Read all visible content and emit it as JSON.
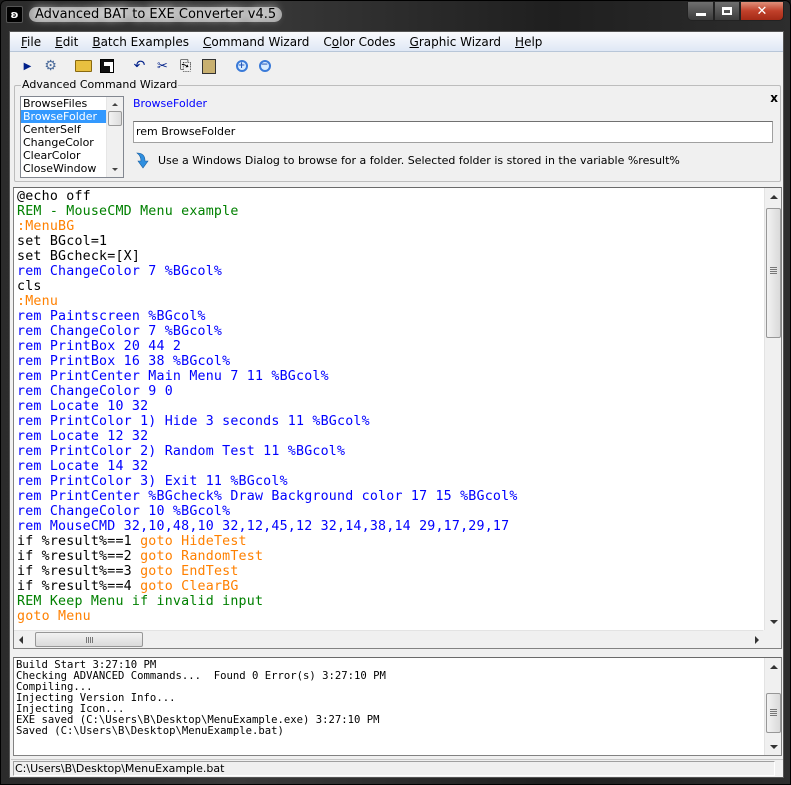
{
  "window": {
    "title": "Advanced BAT to EXE Converter v4.5",
    "app_icon": "bat-converter-logo-icon",
    "caption_buttons": {
      "minimize": "minimize-icon",
      "maximize": "maximize-icon",
      "close": "close-icon"
    }
  },
  "menubar": {
    "items": [
      {
        "label": "File",
        "accel": "F",
        "rest": "ile"
      },
      {
        "label": "Edit",
        "accel": "E",
        "rest": "dit"
      },
      {
        "label": "Batch Examples",
        "accel": "B",
        "rest": "atch Examples"
      },
      {
        "label": "Command Wizard",
        "accel": "C",
        "rest": "ommand Wizard"
      },
      {
        "label": "Color Codes",
        "pre": "C",
        "accel": "o",
        "rest": "lor Codes"
      },
      {
        "label": "Graphic Wizard",
        "accel": "G",
        "rest": "raphic Wizard"
      },
      {
        "label": "Help",
        "accel": "H",
        "rest": "elp"
      }
    ]
  },
  "toolbar": {
    "buttons": [
      {
        "name": "run",
        "icon": "play-icon",
        "glyph": "▶"
      },
      {
        "name": "build",
        "icon": "build-exe-icon",
        "glyph": "⚙"
      },
      {
        "name": "open",
        "icon": "open-folder-icon",
        "glyph": "📂"
      },
      {
        "name": "save",
        "icon": "save-disk-icon",
        "glyph": "💾"
      },
      {
        "name": "undo",
        "icon": "undo-icon",
        "glyph": "↶"
      },
      {
        "name": "cut",
        "icon": "scissors-icon",
        "glyph": "✂"
      },
      {
        "name": "copy",
        "icon": "copy-icon",
        "glyph": "⎘"
      },
      {
        "name": "paste",
        "icon": "paste-icon",
        "glyph": "📋"
      },
      {
        "name": "zoom-in",
        "icon": "zoom-in-icon",
        "glyph": "⊕"
      },
      {
        "name": "zoom-out",
        "icon": "zoom-out-icon",
        "glyph": "⊖"
      }
    ]
  },
  "wizard": {
    "legend": "Advanced Command Wizard",
    "close_label": "x",
    "commands": [
      "BrowseFiles",
      "BrowseFolder",
      "CenterSelf",
      "ChangeColor",
      "ClearColor",
      "CloseWindow"
    ],
    "selected_index": 1,
    "selected_name": "BrowseFolder",
    "input_value": "rem BrowseFolder",
    "description": "Use a Windows Dialog to browse for a folder.  Selected folder is stored in the variable %result%"
  },
  "editor": {
    "colors": {
      "default": "#000000",
      "comment": "#008000",
      "label": "#ff8000",
      "command": "#0000ff"
    },
    "lines": [
      [
        {
          "t": "@echo off",
          "c": "black"
        }
      ],
      [
        {
          "t": "REM - MouseCMD Menu example",
          "c": "green"
        }
      ],
      [
        {
          "t": ":MenuBG",
          "c": "orange"
        }
      ],
      [
        {
          "t": "set BGcol=1",
          "c": "black"
        }
      ],
      [
        {
          "t": "set BGcheck=[X]",
          "c": "black"
        }
      ],
      [
        {
          "t": "rem ChangeColor 7 %BGcol%",
          "c": "blue"
        }
      ],
      [
        {
          "t": "cls",
          "c": "black"
        }
      ],
      [
        {
          "t": ":Menu",
          "c": "orange"
        }
      ],
      [
        {
          "t": "rem Paintscreen %BGcol%",
          "c": "blue"
        }
      ],
      [
        {
          "t": "rem ChangeColor 7 %BGcol%",
          "c": "blue"
        }
      ],
      [
        {
          "t": "rem PrintBox 20 44 2",
          "c": "blue"
        }
      ],
      [
        {
          "t": "rem PrintBox 16 38 %BGcol%",
          "c": "blue"
        }
      ],
      [
        {
          "t": "rem PrintCenter Main Menu 7 11 %BGcol%",
          "c": "blue"
        }
      ],
      [
        {
          "t": "rem ChangeColor 9 0",
          "c": "blue"
        }
      ],
      [
        {
          "t": "rem Locate 10 32",
          "c": "blue"
        }
      ],
      [
        {
          "t": "rem PrintColor 1) Hide 3 seconds 11 %BGcol%",
          "c": "blue"
        }
      ],
      [
        {
          "t": "rem Locate 12 32",
          "c": "blue"
        }
      ],
      [
        {
          "t": "rem PrintColor 2) Random Test 11 %BGcol%",
          "c": "blue"
        }
      ],
      [
        {
          "t": "rem Locate 14 32",
          "c": "blue"
        }
      ],
      [
        {
          "t": "rem PrintColor 3) Exit 11 %BGcol%",
          "c": "blue"
        }
      ],
      [
        {
          "t": "rem PrintCenter %BGcheck% Draw Background color 17 15 %BGcol%",
          "c": "blue"
        }
      ],
      [
        {
          "t": "rem ChangeColor 10 %BGcol%",
          "c": "blue"
        }
      ],
      [
        {
          "t": "rem MouseCMD 32,10,48,10 32,12,45,12 32,14,38,14 29,17,29,17",
          "c": "blue"
        }
      ],
      [
        {
          "t": "if %result%==1 ",
          "c": "black"
        },
        {
          "t": "goto HideTest",
          "c": "orange"
        }
      ],
      [
        {
          "t": "if %result%==2 ",
          "c": "black"
        },
        {
          "t": "goto RandomTest",
          "c": "orange"
        }
      ],
      [
        {
          "t": "if %result%==3 ",
          "c": "black"
        },
        {
          "t": "goto EndTest",
          "c": "orange"
        }
      ],
      [
        {
          "t": "if %result%==4 ",
          "c": "black"
        },
        {
          "t": "goto ClearBG",
          "c": "orange"
        }
      ],
      [
        {
          "t": "REM Keep Menu if invalid input",
          "c": "green"
        }
      ],
      [
        {
          "t": "goto Menu",
          "c": "orange"
        }
      ]
    ]
  },
  "output": {
    "lines": [
      "Build Start 3:27:10 PM",
      "Checking ADVANCED Commands...  Found 0 Error(s) 3:27:10 PM",
      "Compiling...",
      "Injecting Version Info...",
      "Injecting Icon...",
      "EXE saved (C:\\Users\\B\\Desktop\\MenuExample.exe) 3:27:10 PM",
      "Saved (C:\\Users\\B\\Desktop\\MenuExample.bat)"
    ]
  },
  "statusbar": {
    "path": "C:\\Users\\B\\Desktop\\MenuExample.bat"
  }
}
